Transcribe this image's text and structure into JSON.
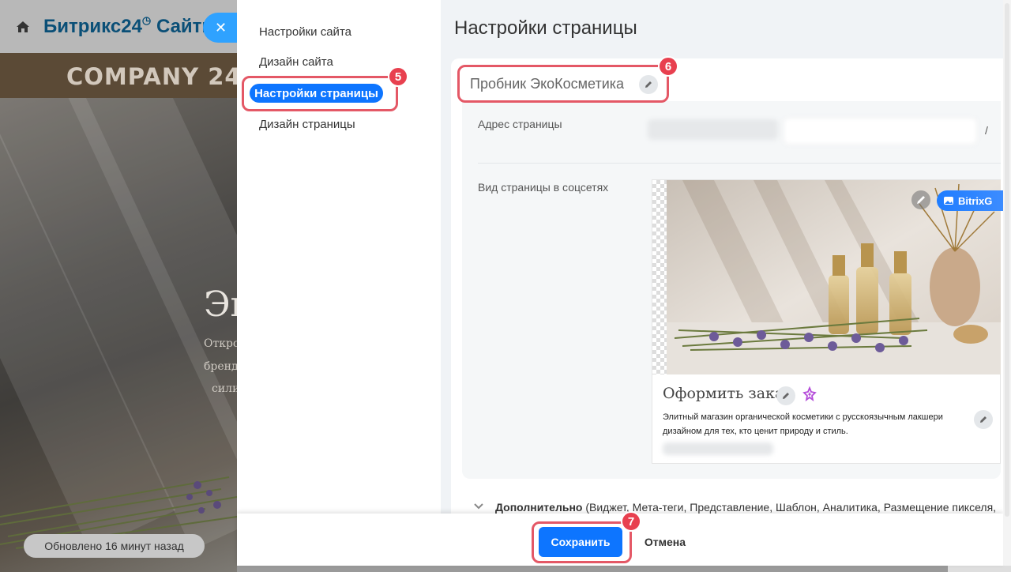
{
  "app": {
    "brand_name": "Битрикс24",
    "brand_sites": "Сайты",
    "close_glyph": "✕"
  },
  "background_site": {
    "company_name": "COMPANY 24",
    "hero_title": "Эк",
    "hero_lines": [
      "Откро",
      "бренд",
      "сили"
    ],
    "updated_text": "Обновлено 16 минут назад"
  },
  "side_menu": {
    "items": [
      {
        "label": "Настройки сайта"
      },
      {
        "label": "Дизайн сайта"
      },
      {
        "label": "Настройки страницы",
        "active": true
      },
      {
        "label": "Дизайн страницы"
      }
    ]
  },
  "page": {
    "heading": "Настройки страницы",
    "title_value": "Пробник ЭкоКосметика",
    "address_label": "Адрес страницы",
    "address_suffix": "/",
    "social_label": "Вид страницы в соцсетях",
    "social_preview": {
      "title": "Оформить заказ",
      "description": "Элитный магазин органической косметики с русскоязычным лакшери дизайном для тех, кто ценит природу и стиль.",
      "ai_badge": "BitrixG"
    },
    "more": {
      "label": "Дополнительно",
      "details": " (Виджет, Мета-теги, Представление, Шаблон, Аналитика, Размещение пикселя,"
    }
  },
  "footer": {
    "save_label": "Сохранить",
    "cancel_label": "Отмена"
  },
  "callouts": [
    "5",
    "6",
    "7"
  ],
  "colors": {
    "accent": "#0d75ff",
    "highlight": "#e45866",
    "badge": "#e8404f"
  }
}
